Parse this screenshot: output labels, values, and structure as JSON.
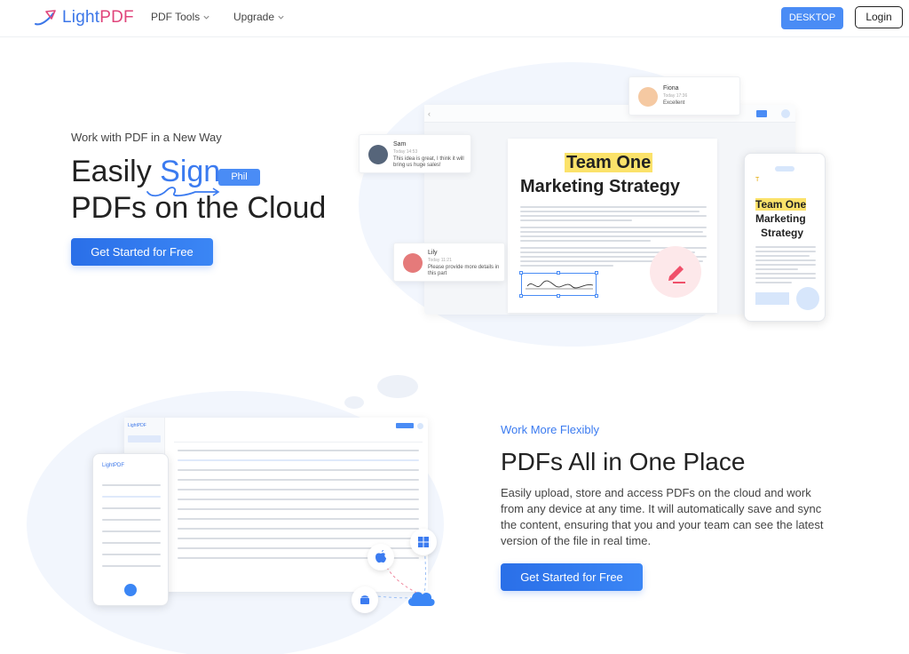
{
  "header": {
    "logo_light": "Light",
    "logo_pdf": "PDF",
    "nav": [
      {
        "label": "PDF Tools"
      },
      {
        "label": "Upgrade"
      }
    ],
    "desktop_label": "DESKTOP",
    "login_label": "Login"
  },
  "hero": {
    "subtitle": "Work with PDF in a New Way",
    "title_line1_a": "Easily ",
    "title_line1_b": "Sign",
    "title_line2": "PDFs on the Cloud",
    "phil_tag": "Phil",
    "cta_label": "Get Started for Free"
  },
  "illustration": {
    "doc_heading_1": "Team One",
    "doc_heading_2": "Marketing Strategy",
    "comments": [
      {
        "name": "Fiona",
        "time": "Today 17:36",
        "text": "Excellent"
      },
      {
        "name": "Sam",
        "time": "Today 14:53",
        "text": "This idea is great, I think it will bring us huge sales!"
      },
      {
        "name": "Lily",
        "time": "Today 11:21",
        "text": "Please provide more details in this part"
      }
    ],
    "phone_heading_1": "Team One",
    "phone_heading_2": "Marketing",
    "phone_heading_3": "Strategy"
  },
  "section2": {
    "kicker": "Work More Flexibly",
    "title": "PDFs All in One Place",
    "description": "Easily upload, store and access PDFs on the cloud and work from any device at any time. It will automatically save and sync the content, ensuring that you and your team can see the latest version of the file in real time.",
    "cta_label": "Get Started for Free"
  },
  "colors": {
    "accent": "#3b7bf0",
    "brand_pink": "#e0457b",
    "highlight": "#fbe26a"
  }
}
